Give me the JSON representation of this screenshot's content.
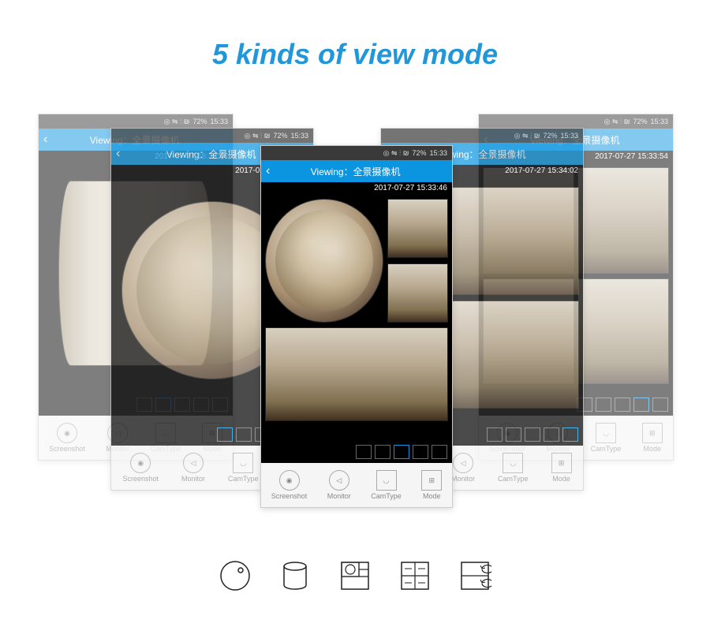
{
  "title": "5 kinds of view mode",
  "statusbar": {
    "signal": "◎ ⇋ ⫶ ₪",
    "battery": "72%",
    "time": "15:33"
  },
  "header": {
    "back": "‹",
    "title": "Viewing：全景摄像机"
  },
  "timestamps": [
    "2017-07-27 15:33:46",
    "2017-07-27 15:33:46",
    "2017-07-27 15:33:46",
    "2017-07-27 15:34:02",
    "2017-07-27 15:33:54"
  ],
  "toolbar": {
    "screenshot": "Screenshot",
    "monitor": "Monitor",
    "camtype": "CamType",
    "mode": "Mode"
  },
  "mode_icons": [
    "fisheye",
    "cylinder",
    "multigrid",
    "quad",
    "timeshift"
  ]
}
